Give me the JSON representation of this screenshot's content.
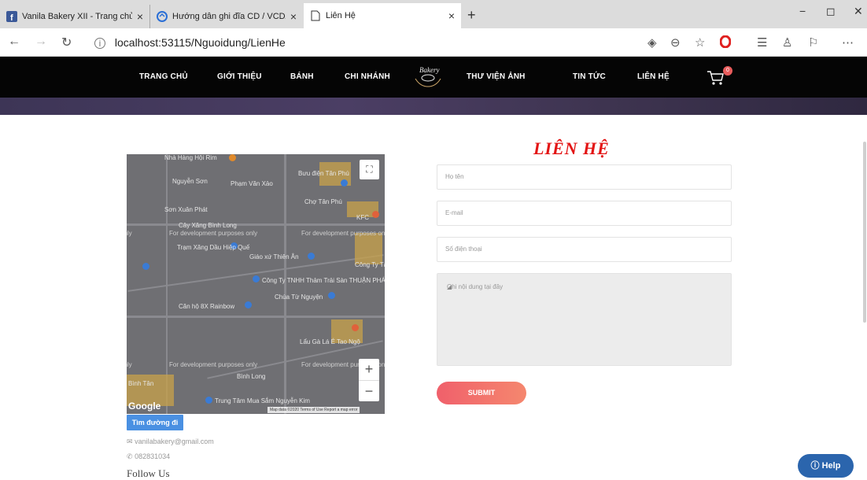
{
  "browser": {
    "tabs": [
      {
        "label": "Vanila Bakery XII - Trang chủ",
        "close": "×"
      },
      {
        "label": "Hướng dẫn ghi đĩa CD / VCD/ D\\",
        "close": "×"
      },
      {
        "label": "Liên Hệ",
        "close": "×"
      }
    ],
    "new_tab": "+",
    "window_controls": {
      "minimize": "−",
      "maximize": "◻",
      "close": "✕"
    },
    "nav": {
      "back": "←",
      "forward": "→",
      "refresh": "↻"
    },
    "url": "localhost:53115/Nguoidung/LienHe",
    "url_info": "i",
    "toolbar_more": "⋯"
  },
  "site_nav": {
    "items": [
      "TRANG CHỦ",
      "GIỚI THIỆU",
      "BÁNH",
      "CHI NHÁNH",
      "THƯ VIỆN ẢNH",
      "TIN TỨC",
      "LIÊN HỆ"
    ],
    "cart_count": "0",
    "logo_text": "Bakery"
  },
  "map": {
    "labels": [
      "Nhà Hàng Hội Rim",
      "Nguyễn Sơn",
      "Bưu điện Tân Phú",
      "Phạm Văn Xảo",
      "Chợ Tân Phú",
      "Sơn Xuân Phát",
      "KFC",
      "Cây Xăng Bình Long",
      "Trạm Xăng Dầu Hiệp Quế",
      "Giáo xứ Thiên Ân",
      "Công Ty TNHH Thảm Trải Sàn THUẬN PHÁT",
      "Chùa Từ Nguyện",
      "Căn hộ 8X Rainbow",
      "Lẩu Gà Lá É Tao Ngộ",
      "Bình Long",
      "Trung Tâm Mua Sắm Nguyễn Kim",
      "Công Ty Tài Ph",
      "Bình Tân"
    ],
    "dev_text": "For development purposes only",
    "fullscreen": "⛶",
    "zoom_in": "+",
    "zoom_out": "−",
    "google": "Google",
    "footer": "Map data ©2020  Terms of Use  Report a map error"
  },
  "directions_button": "Tìm đường đi",
  "contact": {
    "email": "vanilabakery@gmail.com",
    "phone": "082831034"
  },
  "follow_us": "Follow Us",
  "form": {
    "title": "LIÊN HỆ",
    "name_placeholder": "Họ tên",
    "email_placeholder": "E-mail",
    "phone_placeholder": "Số điện thoại",
    "message_placeholder": "Ghi nội dung tại đây",
    "submit": "SUBMIT"
  },
  "help_button": "Help",
  "colors": {
    "nav_bg": "#050505",
    "title_red": "#e31414",
    "submit_start": "#f0606b",
    "submit_end": "#f5876e",
    "help_bg": "#2b65ad"
  }
}
